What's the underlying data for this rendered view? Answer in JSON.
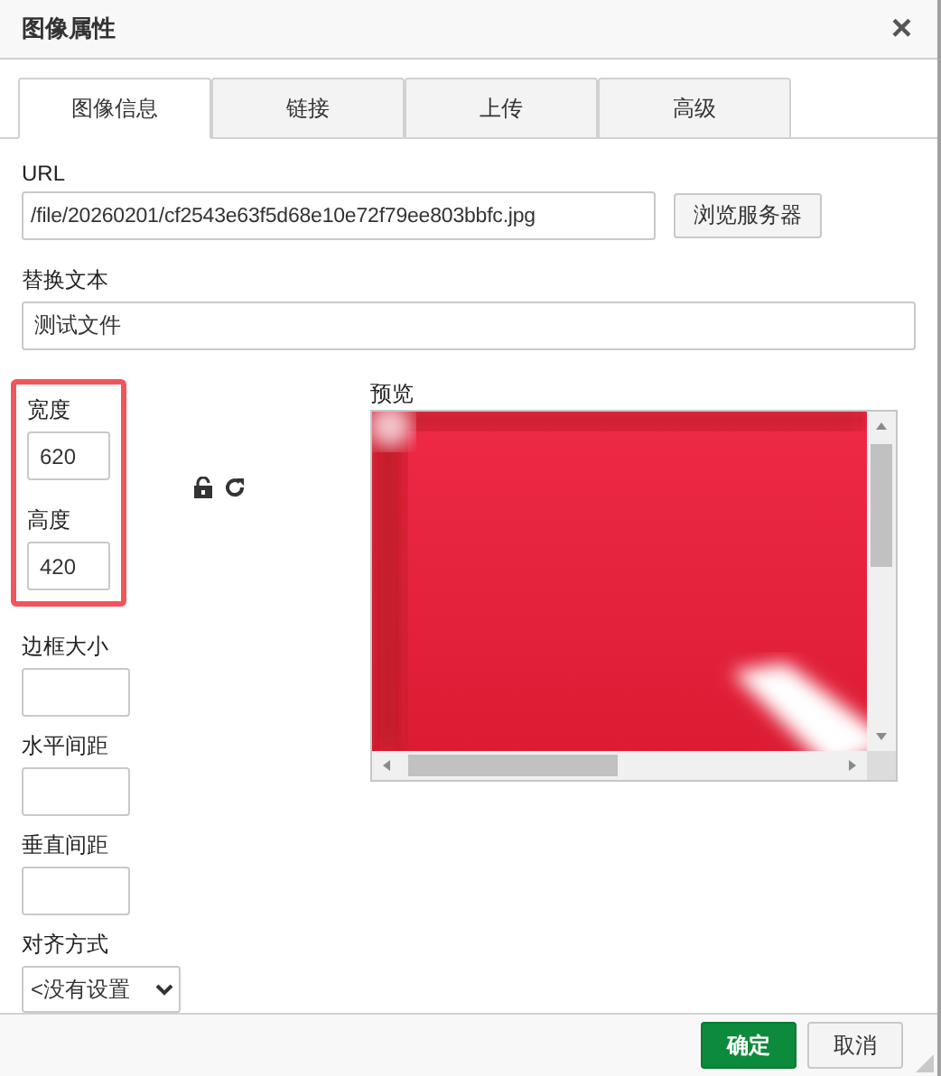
{
  "dialog": {
    "title": "图像属性",
    "close": "×"
  },
  "tabs": [
    {
      "label": "图像信息",
      "selected": true
    },
    {
      "label": "链接",
      "selected": false
    },
    {
      "label": "上传",
      "selected": false
    },
    {
      "label": "高级",
      "selected": false
    }
  ],
  "url": {
    "label": "URL",
    "value": "/file/20260201/cf2543e63f5d68e10e72f79ee803bbfc.jpg",
    "browse_button": "浏览服务器"
  },
  "alt_text": {
    "label": "替换文本",
    "value": "测试文件"
  },
  "size": {
    "highlighted": true,
    "width": {
      "label": "宽度",
      "value": "620"
    },
    "height": {
      "label": "高度",
      "value": "420"
    },
    "ratio_locked": false
  },
  "spacing_fields": [
    {
      "label": "边框大小"
    },
    {
      "label": "水平间距"
    },
    {
      "label": "垂直间距"
    }
  ],
  "align": {
    "label": "对齐方式",
    "value": "<没有设置"
  },
  "preview": {
    "label": "预览"
  },
  "buttons": [
    {
      "label": "确定",
      "kind": "primary"
    },
    {
      "label": "取消",
      "kind": "secondary"
    }
  ]
}
